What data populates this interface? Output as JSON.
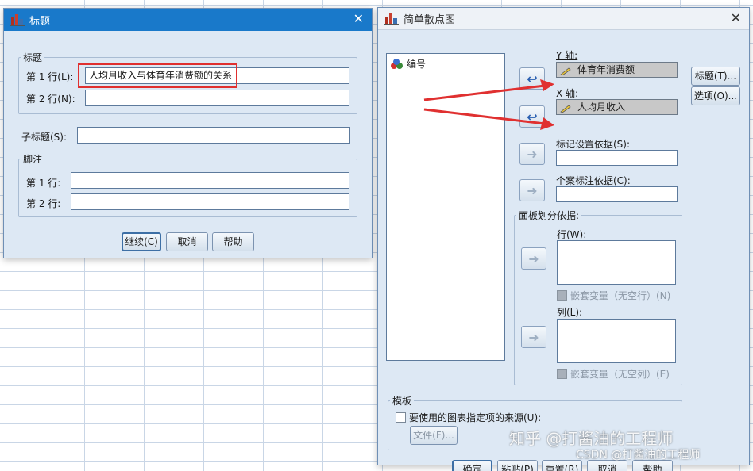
{
  "title_dialog": {
    "window_title": "标题",
    "title_group": {
      "legend": "标题",
      "line1_label": "第 1 行(L):",
      "line1_value": "人均月收入与体育年消费额的关系",
      "line2_label": "第 2 行(N):",
      "line2_value": ""
    },
    "subtitle_label": "子标题(S):",
    "subtitle_value": "",
    "footnote_group": {
      "legend": "脚注",
      "line1_label": "第 1 行:",
      "line1_value": "",
      "line2_label": "第 2 行:",
      "line2_value": ""
    },
    "buttons": {
      "continue": "继续(C)",
      "cancel": "取消",
      "help": "帮助"
    }
  },
  "scatter_dialog": {
    "window_title": "简单散点图",
    "variables": [
      {
        "name": "编号",
        "icon": "nominal-variable-icon"
      }
    ],
    "y_axis": {
      "label": "Y 轴:",
      "value": "体育年消费额",
      "icon": "scale-variable-icon"
    },
    "x_axis": {
      "label": "X 轴:",
      "value": "人均月收入",
      "icon": "scale-variable-icon"
    },
    "marker_label": "标记设置依据(S):",
    "marker_value": "",
    "case_label": "个案标注依据(C):",
    "case_value": "",
    "panel": {
      "legend": "面板划分依据:",
      "rows_label": "行(W):",
      "rows_nest": "嵌套变量（无空行）(N)",
      "cols_label": "列(L):",
      "cols_nest": "嵌套变量（无空列）(E)"
    },
    "template": {
      "legend": "模板",
      "checkbox_label": "要使用的图表指定项的来源(U):",
      "file_button": "文件(F)..."
    },
    "side_buttons": {
      "titles": "标题(T)...",
      "options": "选项(O)..."
    },
    "bottom_buttons": {
      "ok": "确定",
      "paste": "粘贴(P)",
      "reset": "重置(R)",
      "cancel": "取消",
      "help": "帮助"
    }
  },
  "watermark": {
    "main": "知乎 @打酱油的工程师",
    "sub": "CSDN @打酱油的工程师"
  },
  "colors": {
    "title_bar_active": "#1979ca",
    "dialog_bg": "#dde8f4",
    "annotation_red": "#e03030"
  }
}
